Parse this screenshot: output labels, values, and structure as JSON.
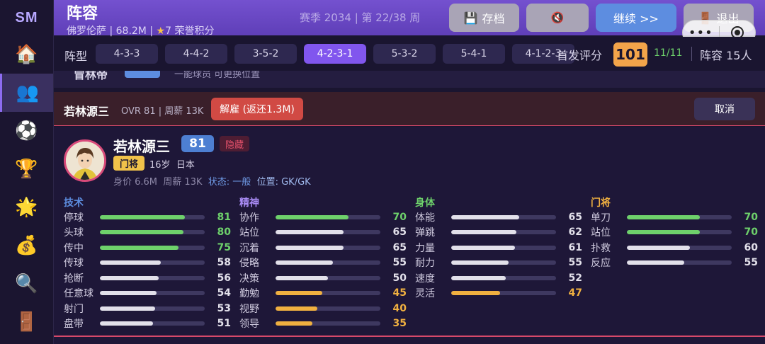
{
  "sidebar": {
    "logo": "SM",
    "items": [
      {
        "icon": "house-icon",
        "glyph": "🏠"
      },
      {
        "icon": "people-icon",
        "glyph": "👥"
      },
      {
        "icon": "soccer-ball-icon",
        "glyph": "⚽"
      },
      {
        "icon": "trophy-icon",
        "glyph": "🏆"
      },
      {
        "icon": "sparkle-icon",
        "glyph": "🌟"
      },
      {
        "icon": "money-bag-icon",
        "glyph": "💰"
      },
      {
        "icon": "magnifier-icon",
        "glyph": "🔍"
      },
      {
        "icon": "door-icon",
        "glyph": "🚪"
      }
    ]
  },
  "header": {
    "title": "阵容",
    "club": "佛罗伦萨",
    "budget": "68.2M",
    "honor_points": "7",
    "honor_label": "荣誉积分",
    "season": "赛季 2034 | 第 22/38 周",
    "save_label": "存档",
    "continue_label": "继续 >>",
    "exit_label": "退出",
    "capsule_dots": "•••"
  },
  "formation": {
    "label": "阵型",
    "options": [
      "4-3-3",
      "4-4-2",
      "3-5-2",
      "4-2-3-1",
      "5-3-2",
      "5-4-1",
      "4-1-2-3"
    ],
    "selected": "4-2-3-1",
    "lineup_label": "首发评分",
    "lineup_score": "101",
    "starters": "11/11",
    "squad": "阵容 15人"
  },
  "partial_row": {
    "name": "冒林帝",
    "text": "一能球员 可更换位置"
  },
  "release": {
    "name": "若林源三",
    "meta": "OVR 81 | 周薪 13K",
    "fire_label": "解雇 (返还1.3M)",
    "cancel_label": "取消"
  },
  "player": {
    "name": "若林源三",
    "ovr": "81",
    "hidden_tag": "隐藏",
    "position_tag": "门将",
    "age": "16岁",
    "nation": "日本",
    "value": "身价 6.6M",
    "wage": "周薪 13K",
    "status_label": "状态:",
    "status": "一般",
    "pos_label": "位置:",
    "positions": "GK/GK"
  },
  "colors": {
    "accent": "#8156ee",
    "high": "#6ed16b",
    "mid": "#e2e0ea",
    "low": "#f0b040"
  },
  "attributes": [
    {
      "title": "技术",
      "title_color": "#5d8de0",
      "items": [
        {
          "label": "停球",
          "value": 81
        },
        {
          "label": "头球",
          "value": 80
        },
        {
          "label": "传中",
          "value": 75
        },
        {
          "label": "传球",
          "value": 58
        },
        {
          "label": "抢断",
          "value": 56
        },
        {
          "label": "任意球",
          "value": 54
        },
        {
          "label": "射门",
          "value": 53
        },
        {
          "label": "盘带",
          "value": 51
        }
      ]
    },
    {
      "title": "精神",
      "title_color": "#a98cf5",
      "items": [
        {
          "label": "协作",
          "value": 70
        },
        {
          "label": "站位",
          "value": 65
        },
        {
          "label": "沉着",
          "value": 65
        },
        {
          "label": "侵略",
          "value": 55
        },
        {
          "label": "决策",
          "value": 50
        },
        {
          "label": "勤勉",
          "value": 45
        },
        {
          "label": "视野",
          "value": 40
        },
        {
          "label": "领导",
          "value": 35
        }
      ]
    },
    {
      "title": "身体",
      "title_color": "#6ed16b",
      "items": [
        {
          "label": "体能",
          "value": 65
        },
        {
          "label": "弹跳",
          "value": 62
        },
        {
          "label": "力量",
          "value": 61
        },
        {
          "label": "耐力",
          "value": 55
        },
        {
          "label": "速度",
          "value": 52
        },
        {
          "label": "灵活",
          "value": 47
        }
      ]
    },
    {
      "title": "门将",
      "title_color": "#f0b040",
      "items": [
        {
          "label": "单刀",
          "value": 70
        },
        {
          "label": "站位",
          "value": 70
        },
        {
          "label": "扑救",
          "value": 60
        },
        {
          "label": "反应",
          "value": 55
        }
      ]
    }
  ]
}
